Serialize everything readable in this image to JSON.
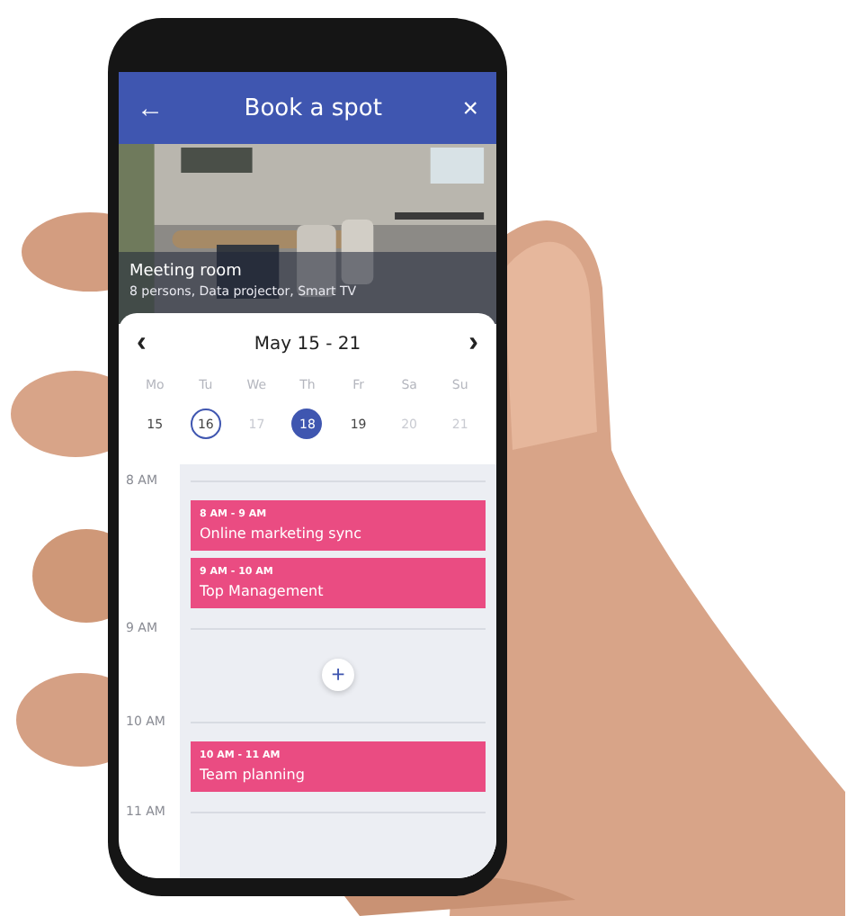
{
  "header": {
    "title": "Book a spot",
    "back": "←",
    "close": "×"
  },
  "room": {
    "name": "Meeting room",
    "details": "8 persons, Data projector, Smart TV"
  },
  "week": {
    "prev": "‹",
    "label": "May 15 - 21",
    "next": "›"
  },
  "days": [
    {
      "name": "Mo",
      "date": "15",
      "today": false,
      "selected": false,
      "disabled": false
    },
    {
      "name": "Tu",
      "date": "16",
      "today": true,
      "selected": false,
      "disabled": false
    },
    {
      "name": "We",
      "date": "17",
      "today": false,
      "selected": false,
      "disabled": true
    },
    {
      "name": "Th",
      "date": "18",
      "today": false,
      "selected": true,
      "disabled": false
    },
    {
      "name": "Fr",
      "date": "19",
      "today": false,
      "selected": false,
      "disabled": false
    },
    {
      "name": "Sa",
      "date": "20",
      "today": false,
      "selected": false,
      "disabled": true
    },
    {
      "name": "Su",
      "date": "21",
      "today": false,
      "selected": false,
      "disabled": true
    }
  ],
  "schedule": [
    {
      "kind": "hour",
      "label": "8 AM"
    },
    {
      "kind": "event",
      "time": "8 AM - 9 AM",
      "title": "Online marketing sync"
    },
    {
      "kind": "event",
      "time": "9 AM - 10 AM",
      "title": "Top Management"
    },
    {
      "kind": "hour",
      "label": "9 AM"
    },
    {
      "kind": "add",
      "label": "+"
    },
    {
      "kind": "hour",
      "label": "10 AM"
    },
    {
      "kind": "event",
      "time": "10 AM - 11 AM",
      "title": "Team planning"
    },
    {
      "kind": "hour",
      "label": "11 AM"
    }
  ]
}
